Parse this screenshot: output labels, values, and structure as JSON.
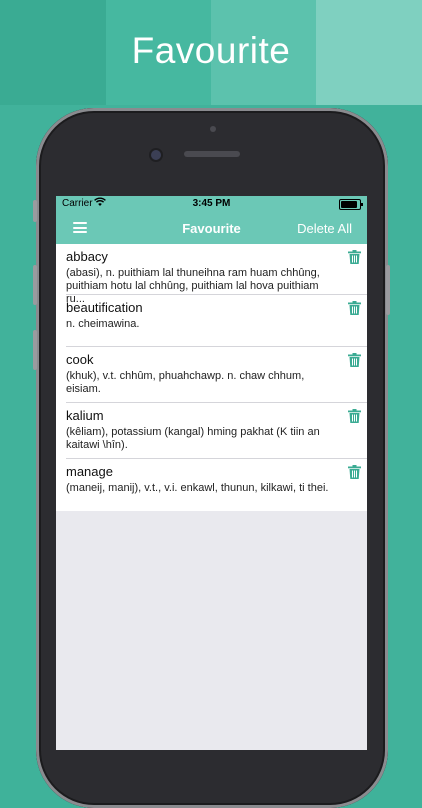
{
  "banner": {
    "title": "Favourite"
  },
  "status_bar": {
    "carrier": "Carrier",
    "time": "3:45 PM"
  },
  "navbar": {
    "title": "Favourite",
    "delete_all": "Delete All"
  },
  "entries": [
    {
      "word": "abbacy",
      "meaning": "(abasi), n. puithiam lal thuneihna ram huam chhûng, puithiam hotu lal chhûng, puithiam lal hova puithiam ru..."
    },
    {
      "word": "beautification",
      "meaning": "n. cheimawina."
    },
    {
      "word": "cook",
      "meaning": "(khuk), v.t. chhûm, phuahchawp. n. chaw chhum, eisiam."
    },
    {
      "word": "kalium",
      "meaning": "(kêliam), potassium (kangal) hming pakhat (K tiin an kaitawi \\hîn)."
    },
    {
      "word": "manage",
      "meaning": "(maneij, manij), v.t., v.i. enkawl, thunun, kilkawi, ti thei."
    }
  ],
  "colors": {
    "accent": "#6bc8b6",
    "trash": "#3aab93",
    "background": "#3fb29a"
  }
}
